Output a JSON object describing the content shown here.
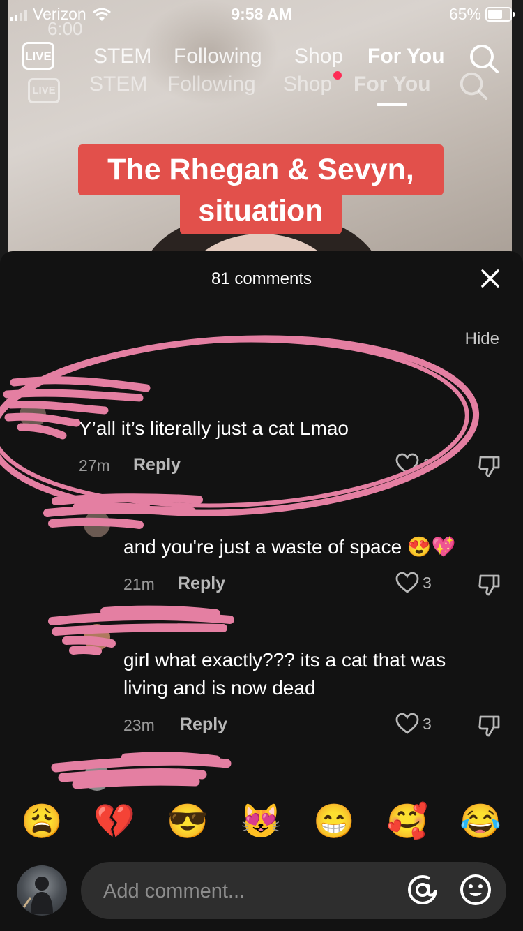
{
  "status_bar": {
    "carrier": "Verizon",
    "time": "9:58 AM",
    "battery": "65%"
  },
  "video": {
    "ghost_time": "6:00",
    "live_label": "LIVE",
    "tabs": [
      {
        "label": "STEM"
      },
      {
        "label": "Following"
      },
      {
        "label": "Shop"
      },
      {
        "label": "For You"
      }
    ],
    "caption_line1": "The Rhegan & Sevyn,",
    "caption_line2": "situation"
  },
  "comments_sheet": {
    "title": "81 comments",
    "hide_label": "Hide",
    "comments": [
      {
        "text": "Y’all it’s literally just a cat Lmao",
        "time": "27m",
        "reply_label": "Reply",
        "likes": "1"
      },
      {
        "text": "and you're just a waste of space 😍💖",
        "time": "21m",
        "reply_label": "Reply",
        "likes": "3"
      },
      {
        "text_line1": "girl what exactly??? its a cat that was",
        "text_line2": "living and is now dead",
        "time": "23m",
        "reply_label": "Reply",
        "likes": "3"
      }
    ],
    "emoji_bar": [
      "😩",
      "💔",
      "😎",
      "😻",
      "😁",
      "🥰",
      "😂"
    ],
    "input": {
      "placeholder": "Add comment..."
    }
  },
  "colors": {
    "accent": "#fe2c55",
    "caption_bg": "#e2504b",
    "scribble": "#e47fa2",
    "sheet_bg": "#121212"
  }
}
